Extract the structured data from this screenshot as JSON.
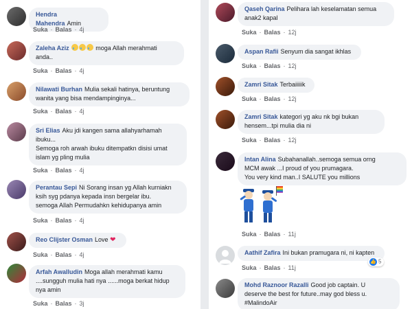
{
  "left_panel": {
    "comments": [
      {
        "name": "Hendra Mahendra",
        "lines": [
          "Amin"
        ],
        "actions": {
          "like": "Suka",
          "reply": "Balas",
          "time": "4j"
        }
      },
      {
        "name": "Zaleha Aziz",
        "lines": [
          "moga Allah merahmati",
          "anda.."
        ],
        "emoji": [
          "crying-face-emoji",
          "crying-face-emoji",
          "crying-face-emoji"
        ],
        "actions": {
          "like": "Suka",
          "reply": "Balas",
          "time": "4j"
        }
      },
      {
        "name": "Nilawati Burhan",
        "lines": [
          "Mulia sekali hatinya, beruntung",
          "wanita yang bisa mendampinginya..."
        ],
        "actions": {
          "like": "Suka",
          "reply": "Balas",
          "time": "4j"
        }
      },
      {
        "name": "Sri Elias",
        "lines": [
          "Aku jdi kangen sama allahyarhamah",
          "ibuku...",
          "Semoga roh arwah ibuku ditempatkn disisi umat",
          "islam yg pling mulia"
        ],
        "actions": {
          "like": "Suka",
          "reply": "Balas",
          "time": "4j"
        }
      },
      {
        "name": "Perantau Sepi",
        "lines": [
          "Ni Sorang insan yg Allah kurniakn",
          "ksih syg pdanya kepada insn bergelar ibu.",
          "semoga Allah Permudahkn kehidupanya amin"
        ],
        "actions": {
          "like": "Suka",
          "reply": "Balas",
          "time": "4j"
        }
      },
      {
        "name": "Reo Clijster Osman",
        "lines": [
          "Love"
        ],
        "emoji": [
          "heart-emoji"
        ],
        "actions": {
          "like": "Suka",
          "reply": "Balas",
          "time": "4j"
        }
      },
      {
        "name": "Arfah Awalludin",
        "lines": [
          "Moga allah merahmati kamu",
          "....sungguh mulia hati nya ......moga berkat hidup",
          "nya amin"
        ],
        "actions": {
          "like": "Suka",
          "reply": "Balas",
          "time": "3j"
        }
      }
    ]
  },
  "right_panel": {
    "comments": [
      {
        "name": "Qaseh Qarina",
        "lines": [
          "Pelihara lah keselamatan semua",
          "anak2 kapal"
        ],
        "actions": {
          "like": "Suka",
          "reply": "Balas",
          "time": "12j"
        }
      },
      {
        "name": "Aspan Rafii",
        "lines": [
          "Senyum dia sangat ikhlas"
        ],
        "actions": {
          "like": "Suka",
          "reply": "Balas",
          "time": "12j"
        }
      },
      {
        "name": "Zamri Sitak",
        "lines": [
          "Terbaiiiiik"
        ],
        "actions": {
          "like": "Suka",
          "reply": "Balas",
          "time": "12j"
        }
      },
      {
        "name": "Zamri Sitak",
        "lines": [
          "kategori yg aku nk bgi bukan",
          "hensem...tpi mulia dia ni"
        ],
        "actions": {
          "like": "Suka",
          "reply": "Balas",
          "time": "12j"
        }
      },
      {
        "name": "Intan Alina",
        "lines": [
          "Subahanallah..semoga semua orng",
          "MCM awak ...I proud of you prumagara.",
          "You very kind man..I SALUTE you millions"
        ],
        "sticker": "saluting-pilots-sticker",
        "actions": {
          "like": "Suka",
          "reply": "Balas",
          "time": "11j"
        }
      },
      {
        "name": "Aathif Zafira",
        "lines": [
          "Ini bukan pramugara ni, ni kapten"
        ],
        "reaction": {
          "icon": "like-reaction-icon",
          "count": "5"
        },
        "actions": {
          "like": "Suka",
          "reply": "Balas",
          "time": "11j"
        }
      },
      {
        "name": "Mohd Raznoor Razalli",
        "lines": [
          "Good job captain. U",
          "deserve the best for future..may god bless u.",
          "#MalindoAir"
        ],
        "actions": {}
      }
    ]
  },
  "colors": {
    "name_link": "#385898",
    "bubble_bg": "#f0f2f5",
    "meta_text": "#65676b",
    "like_blue": "#1877f2",
    "divider": "#e9ebee"
  }
}
